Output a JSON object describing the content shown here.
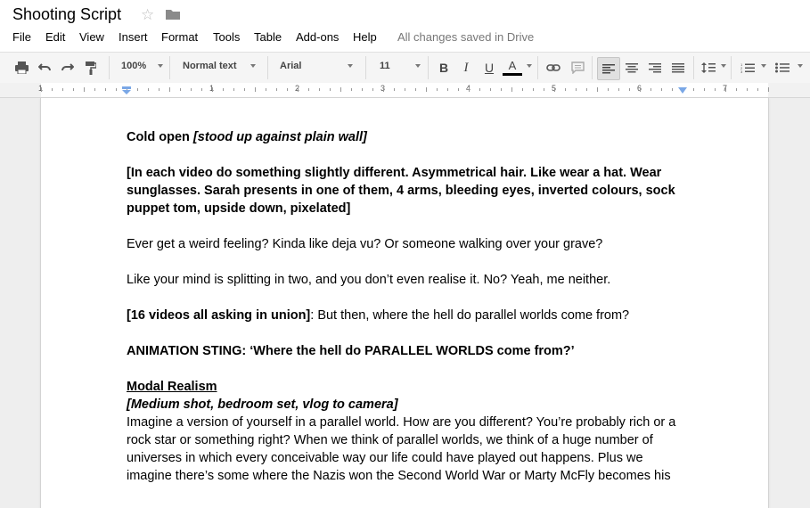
{
  "app": {
    "title": "Shooting Script",
    "save_status": "All changes saved in Drive"
  },
  "menu": [
    "File",
    "Edit",
    "View",
    "Insert",
    "Format",
    "Tools",
    "Table",
    "Add-ons",
    "Help"
  ],
  "toolbar": {
    "zoom": "100%",
    "style": "Normal text",
    "font": "Arial",
    "size": "11",
    "bold": "B",
    "italic": "I",
    "underline": "U",
    "text_color": "A",
    "text_color_swatch": "#000000"
  },
  "ruler": {
    "labels": [
      "1",
      "1",
      "2",
      "3",
      "4",
      "5",
      "6",
      "7"
    ]
  },
  "document": {
    "p1_bold": "Cold open ",
    "p1_bi": "[stood up against plain wall]",
    "p2_bold": "[In each video do something slightly different. Asymmetrical hair. Like wear a hat. Wear sunglasses. Sarah presents in one of them, 4 arms, bleeding eyes, inverted colours, sock puppet tom, upside down, pixelated]",
    "p3": "Ever get a weird feeling? Kinda like deja vu? Or someone walking over your grave?",
    "p4": "Like your mind is splitting in two, and you don’t even realise it. No? Yeah, me neither.",
    "p5_bold": "[16 videos all asking in union]",
    "p5_rest": ": But then, where the hell do parallel worlds come from?",
    "p6_bold": "ANIMATION STING: ‘Where the hell do PARALLEL WORLDS come from?’",
    "p7_heading": "Modal Realism",
    "p8_bi": "[Medium shot, bedroom set, vlog to camera]",
    "p9": "Imagine a version of yourself in a parallel world. How are you different? You’re probably rich or a rock star or something right? When we think of parallel worlds, we think of a huge number of universes in which every conceivable way our life could have played out happens. Plus we imagine there’s some where the Nazis won the Second World War or Marty McFly becomes his"
  }
}
